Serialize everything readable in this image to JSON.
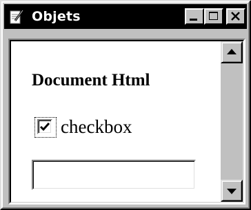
{
  "window": {
    "title": "Objets",
    "icon": "document-pen-icon"
  },
  "titlebar_buttons": {
    "minimize": "minimize-icon",
    "maximize": "maximize-icon",
    "close": "close-icon"
  },
  "content": {
    "heading": "Document Html",
    "checkbox": {
      "label": "checkbox",
      "checked": true
    },
    "text_input": {
      "value": ""
    }
  },
  "scrollbar": {
    "up": "arrow-up-icon",
    "down": "arrow-down-icon"
  },
  "colors": {
    "titlebar": "#000000",
    "face": "#c0c0c0",
    "client": "#ffffff"
  }
}
